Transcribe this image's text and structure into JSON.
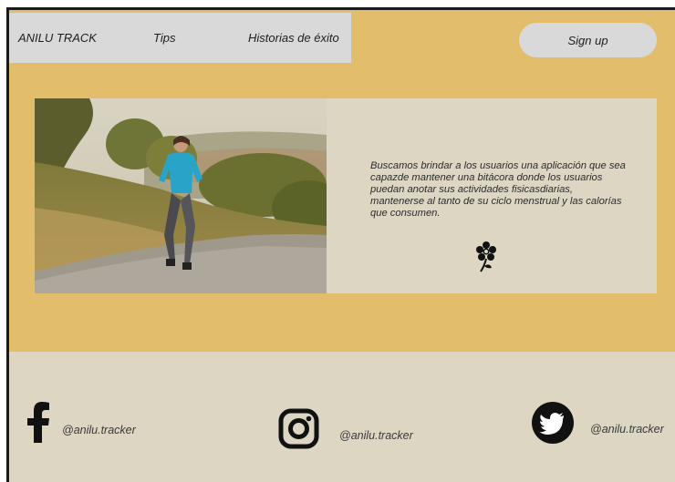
{
  "nav": {
    "brand": "ANILU TRACK",
    "tips": "Tips",
    "historias": "Historias de éxito",
    "signup": "Sign up"
  },
  "hero": {
    "description": "Buscamos brindar a los usuarios una aplicación que sea capazde mantener una bitácora donde los usuarios puedan anotar sus actividades fisicasdiarias, mantenerse al tanto de su ciclo menstrual y las calorías que consumen.",
    "image_icon": "woman-running-photo",
    "decoration_icon": "flower-icon"
  },
  "footer": {
    "facebook": {
      "icon": "facebook-icon",
      "handle": "@anilu.tracker"
    },
    "instagram": {
      "icon": "instagram-icon",
      "handle": "@anilu.tracker"
    },
    "twitter": {
      "icon": "twitter-icon",
      "handle": "@anilu.tracker"
    }
  },
  "colors": {
    "background": "#e2bd6b",
    "nav_bg": "#d9d9d9",
    "panel_bg": "#dcd6c3",
    "text": "#1e1e1e"
  }
}
